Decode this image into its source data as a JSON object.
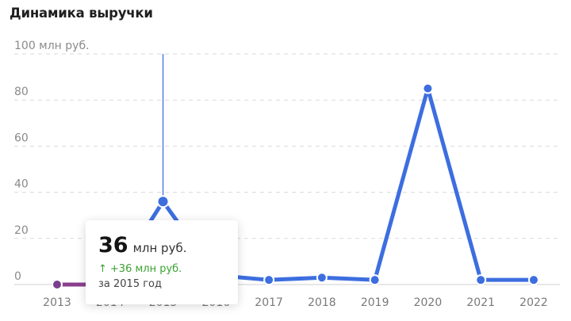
{
  "title": "Динамика выручки",
  "chart_data": {
    "type": "line",
    "title": "Динамика выручки",
    "ylabel": "",
    "xlabel": "",
    "unit_label": "млн руб.",
    "ylim": [
      0,
      100
    ],
    "y_ticks": [
      {
        "value": 0,
        "label": "0"
      },
      {
        "value": 20,
        "label": "20"
      },
      {
        "value": 40,
        "label": "40"
      },
      {
        "value": 60,
        "label": "60"
      },
      {
        "value": 80,
        "label": "80"
      },
      {
        "value": 100,
        "label": "100 млн руб."
      }
    ],
    "x": [
      "2013",
      "2014",
      "2015",
      "2016",
      "2017",
      "2018",
      "2019",
      "2020",
      "2021",
      "2022"
    ],
    "values": [
      0,
      0,
      36,
      4,
      2,
      3,
      2,
      85,
      2,
      2
    ],
    "grid": true,
    "colors": {
      "line": "#3d6ee0",
      "line_low": "#8a3f8e",
      "marker_fill": "#3d6ee0",
      "marker_low": "#7a3f8f",
      "grid": "#d9d9d9",
      "cursor": "#3d6ee0"
    },
    "highlighted_index": 2
  },
  "tooltip": {
    "value": "36",
    "unit": "млн руб.",
    "change_arrow": "↑",
    "change": "+36 млн руб.",
    "period": "за 2015 год"
  }
}
